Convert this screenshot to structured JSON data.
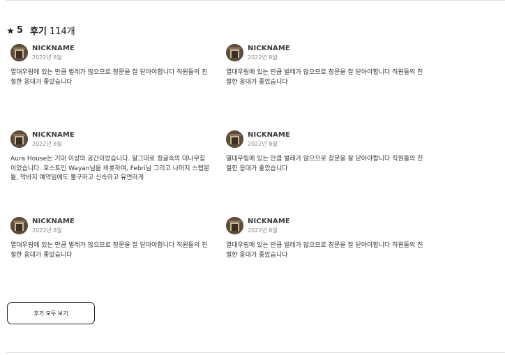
{
  "rating": {
    "value": "5",
    "label": "후기",
    "count": "114개",
    "icon": "star-icon"
  },
  "reviews": [
    {
      "nickname": "NICKNAME",
      "date": "2022년 8월",
      "text": "열대우림에 있는 만큼 벌레가 많으므로 창문을 잘 닫아야합니다 직원들의 친절한 응대가 좋았습니다"
    },
    {
      "nickname": "NICKNAME",
      "date": "2022년 8월",
      "text": "열대우림에 있는 만큼 벌레가 많으므로 창문을 잘 닫아야합니다 직원들의 친절한 응대가 좋았습니다"
    },
    {
      "nickname": "NICKNAME",
      "date": "2022년 8월",
      "text": "Aura House는 기대 이상의 공간이었습니다. 말그대로 정글속의 대나무집이었습니다. 호스트인 Wayan님을 비롯하여, Febri님 그리고 나머지 스텝분들, 막바지 예약임에도 불구하고 신속하고 유연하게"
    },
    {
      "nickname": "NICKNAME",
      "date": "2022년 8월",
      "text": "열대우림에 있는 만큼 벌레가 많으므로 창문을 잘 닫아야합니다 직원들의 친절한 응대가 좋았습니다"
    },
    {
      "nickname": "NICKNAME",
      "date": "2022년 8월",
      "text": "열대우림에 있는 만큼 벌레가 많으므로 창문을 잘 닫아야합니다 직원들의 친절한 응대가 좋았습니다"
    },
    {
      "nickname": "NICKNAME",
      "date": "2022년 8월",
      "text": "열대우림에 있는 만큼 벌레가 많으므로 창문을 잘 닫아야합니다 직원들의 친절한 응대가 좋았습니다"
    }
  ],
  "view_all_button": {
    "label": "후기 모두 보기"
  },
  "colors": {
    "text": "#222222",
    "divider": "#e2e2e2",
    "muted": "#888888"
  }
}
